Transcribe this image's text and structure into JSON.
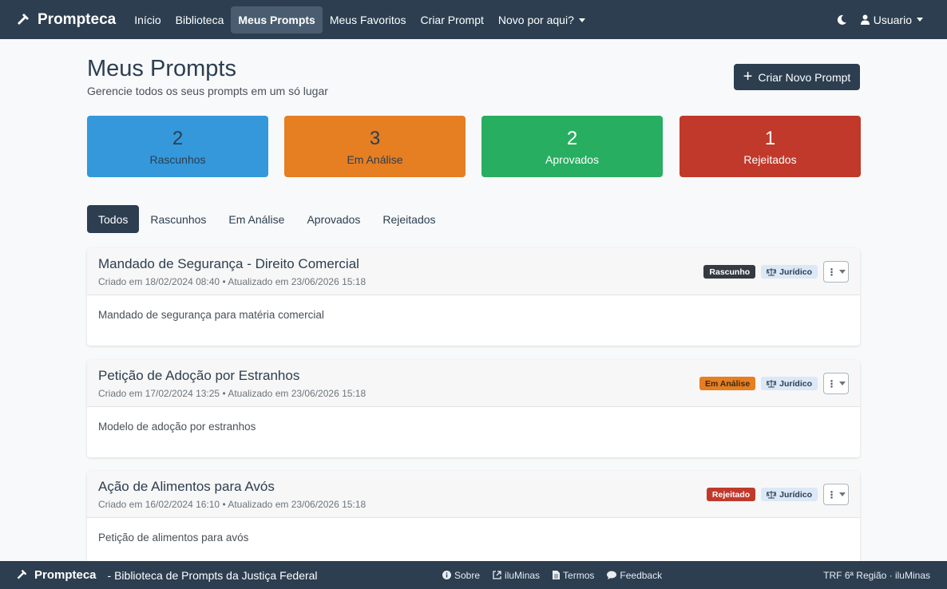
{
  "nav": {
    "brand": "Prompteca",
    "links": [
      "Início",
      "Biblioteca",
      "Meus Prompts",
      "Meus Favoritos",
      "Criar Prompt",
      "Novo por aqui?"
    ],
    "user_label": "Usuario"
  },
  "header": {
    "title": "Meus Prompts",
    "subtitle": "Gerencie todos os seus prompts em um só lugar",
    "create_button": "Criar Novo Prompt"
  },
  "stats": [
    {
      "value": "2",
      "label": "Rascunhos"
    },
    {
      "value": "3",
      "label": "Em Análise"
    },
    {
      "value": "2",
      "label": "Aprovados"
    },
    {
      "value": "1",
      "label": "Rejeitados"
    }
  ],
  "tabs": [
    "Todos",
    "Rascunhos",
    "Em Análise",
    "Aprovados",
    "Rejeitados"
  ],
  "prompts": [
    {
      "title": "Mandado de Segurança - Direito Comercial",
      "meta": "Criado em 18/02/2024 08:40 • Atualizado em 23/06/2026 15:18",
      "status": "Rascunho",
      "category": "Jurídico",
      "description": "Mandado de segurança para matéria comercial"
    },
    {
      "title": "Petição de Adoção por Estranhos",
      "meta": "Criado em 17/02/2024 13:25 • Atualizado em 23/06/2026 15:18",
      "status": "Em Análise",
      "category": "Jurídico",
      "description": "Modelo de adoção por estranhos"
    },
    {
      "title": "Ação de Alimentos para Avós",
      "meta": "Criado em 16/02/2024 16:10 • Atualizado em 23/06/2026 15:18",
      "status": "Rejeitado",
      "category": "Jurídico",
      "description": "Petição de alimentos para avós"
    }
  ],
  "footer": {
    "brand": "Prompteca",
    "tagline": "- Biblioteca de Prompts da Justiça Federal",
    "links": [
      "Sobre",
      "iluMinas",
      "Termos",
      "Feedback"
    ],
    "right": "TRF 6ª Região · iluMinas"
  },
  "colors": {
    "navbar": "#2c3e50",
    "drafts": "#3498db",
    "review": "#e67e22",
    "approved": "#27ae60",
    "rejected": "#c0392b"
  }
}
